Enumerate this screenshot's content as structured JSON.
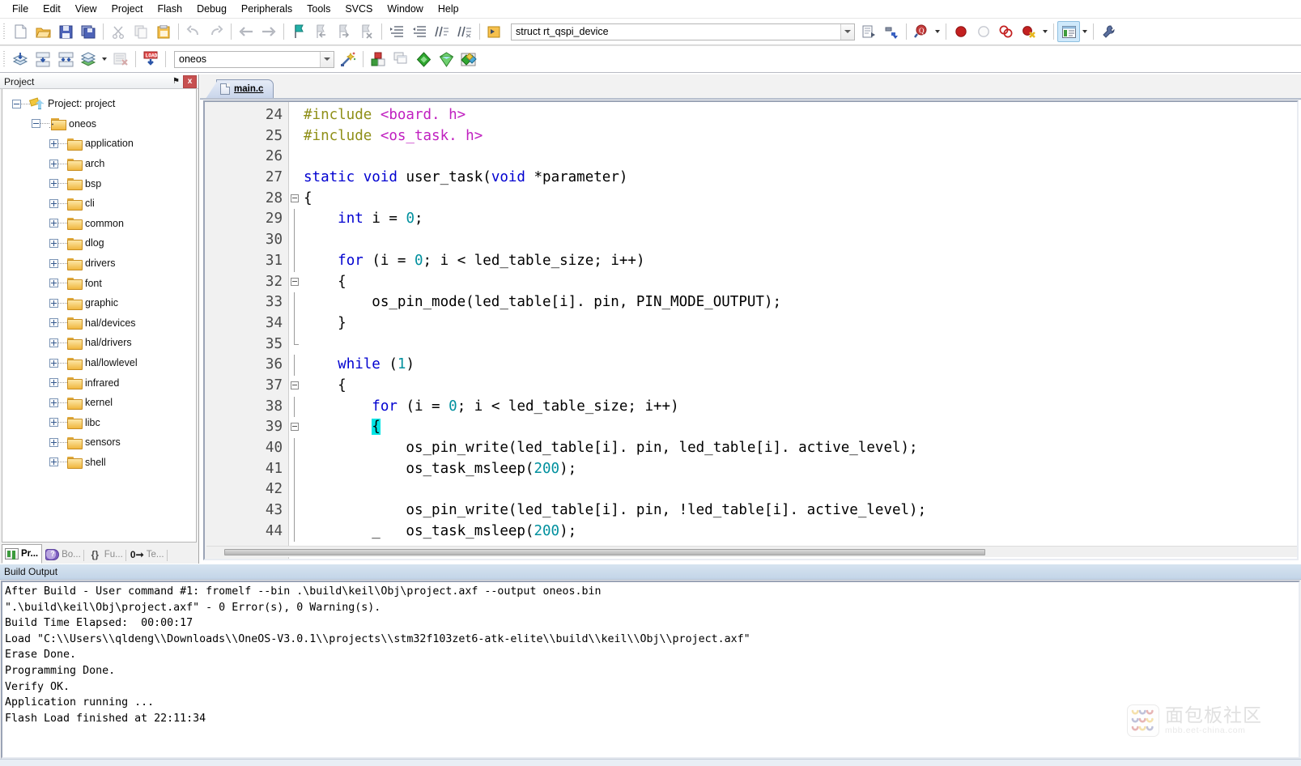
{
  "menubar": {
    "items": [
      "File",
      "Edit",
      "View",
      "Project",
      "Flash",
      "Debug",
      "Peripherals",
      "Tools",
      "SVCS",
      "Window",
      "Help"
    ]
  },
  "toolbar_main": {
    "buttons": [
      {
        "name": "new-file",
        "icon": "new-document-icon",
        "label": "New"
      },
      {
        "name": "open-file",
        "icon": "open-folder-icon",
        "label": "Open"
      },
      {
        "name": "save-file",
        "icon": "floppy-save-icon",
        "label": "Save"
      },
      {
        "name": "save-all",
        "icon": "save-all-icon",
        "label": "Save All"
      },
      {
        "name": "cut",
        "icon": "scissors-icon",
        "label": "Cut"
      },
      {
        "name": "copy",
        "icon": "copy-icon",
        "label": "Copy"
      },
      {
        "name": "paste",
        "icon": "clipboard-paste-icon",
        "label": "Paste"
      },
      {
        "name": "undo",
        "icon": "undo-arrow-icon",
        "label": "Undo"
      },
      {
        "name": "redo",
        "icon": "redo-arrow-icon",
        "label": "Redo"
      },
      {
        "name": "navigate-back",
        "icon": "arrow-left-icon",
        "label": "Back"
      },
      {
        "name": "navigate-forward",
        "icon": "arrow-right-icon",
        "label": "Forward"
      },
      {
        "name": "toggle-bookmark",
        "icon": "bookmark-flag-icon",
        "label": "Insert/Remove Bookmark"
      },
      {
        "name": "prev-bookmark",
        "icon": "bookmark-prev-icon",
        "label": "Previous Bookmark"
      },
      {
        "name": "next-bookmark",
        "icon": "bookmark-next-icon",
        "label": "Next Bookmark"
      },
      {
        "name": "clear-bookmarks",
        "icon": "bookmark-clear-icon",
        "label": "Clear All Bookmarks"
      },
      {
        "name": "indent-right",
        "icon": "indent-right-icon",
        "label": "Indent"
      },
      {
        "name": "indent-left",
        "icon": "indent-left-icon",
        "label": "Outdent"
      },
      {
        "name": "comment-block",
        "icon": "comment-lines-icon",
        "label": "Comment"
      },
      {
        "name": "uncomment-block",
        "icon": "uncomment-lines-icon",
        "label": "Uncomment"
      }
    ],
    "symbol_combo": {
      "value": "struct rt_qspi_device",
      "placeholder": "struct rt_qspi_device"
    },
    "buttons_right": [
      {
        "name": "browse-symbols",
        "icon": "document-browse-icon",
        "label": "Browse Symbols"
      },
      {
        "name": "build-target",
        "icon": "hammer-target-icon",
        "label": "Build Target"
      },
      {
        "name": "find-in-files",
        "icon": "find-magnifier-icon",
        "label": "Find in Files"
      },
      {
        "name": "insert-breakpoint",
        "icon": "red-circle-breakpoint-icon",
        "label": "Insert/Remove Breakpoint"
      },
      {
        "name": "disable-breakpoint",
        "icon": "hollow-circle-breakpoint-icon",
        "label": "Disable Breakpoint"
      },
      {
        "name": "disable-all-breakpoints",
        "icon": "two-rings-breakpoint-icon",
        "label": "Disable All Breakpoints"
      },
      {
        "name": "kill-all-breakpoints",
        "icon": "breakpoint-kill-icon",
        "label": "Kill All Breakpoints"
      },
      {
        "name": "manage-windows",
        "icon": "window-layout-icon",
        "label": "Manage Windows"
      },
      {
        "name": "configure-target",
        "icon": "wrench-icon",
        "label": "Configure Target Options"
      }
    ]
  },
  "toolbar_build": {
    "buttons": [
      {
        "name": "translate-file",
        "icon": "translate-layers-icon",
        "label": "Translate"
      },
      {
        "name": "build",
        "icon": "build-down-icon",
        "label": "Build"
      },
      {
        "name": "rebuild",
        "icon": "rebuild-all-icon",
        "label": "Rebuild"
      },
      {
        "name": "batch-build",
        "icon": "batch-build-icon",
        "label": "Batch Build"
      },
      {
        "name": "stop-build",
        "icon": "stop-build-icon",
        "label": "Stop Build"
      },
      {
        "name": "download-to-flash",
        "icon": "load-flash-icon",
        "label": "Download"
      }
    ],
    "target_combo": {
      "value": "oneos",
      "placeholder": "oneos"
    },
    "buttons_right": [
      {
        "name": "manage-project-items",
        "icon": "magic-wand-icon",
        "label": "Manage Project Items"
      },
      {
        "name": "select-components",
        "icon": "components-blocks-icon",
        "label": "Select Software Packs"
      },
      {
        "name": "multi-project-window",
        "icon": "multi-window-icon",
        "label": "Multi-Project Window"
      },
      {
        "name": "pack-installer",
        "icon": "green-diamond-icon",
        "label": "Pack Installer"
      },
      {
        "name": "pack-filter",
        "icon": "funnel-icon",
        "label": "Filter Packs"
      },
      {
        "name": "pack-manage",
        "icon": "pack-manage-icon",
        "label": "Manage Packs"
      }
    ]
  },
  "project_panel": {
    "title": "Project",
    "pin_label": "⚑",
    "close_label": "x",
    "tree": [
      {
        "label": "Project: project",
        "icon": "project-icon",
        "expander": "minus",
        "depth": 0
      },
      {
        "label": "oneos",
        "icon": "target-group-icon",
        "expander": "minus",
        "depth": 1
      },
      {
        "label": "application",
        "icon": "folder-icon",
        "expander": "plus",
        "depth": 2
      },
      {
        "label": "arch",
        "icon": "folder-icon",
        "expander": "plus",
        "depth": 2
      },
      {
        "label": "bsp",
        "icon": "folder-icon",
        "expander": "plus",
        "depth": 2
      },
      {
        "label": "cli",
        "icon": "folder-icon",
        "expander": "plus",
        "depth": 2
      },
      {
        "label": "common",
        "icon": "folder-icon",
        "expander": "plus",
        "depth": 2
      },
      {
        "label": "dlog",
        "icon": "folder-icon",
        "expander": "plus",
        "depth": 2
      },
      {
        "label": "drivers",
        "icon": "folder-icon",
        "expander": "plus",
        "depth": 2
      },
      {
        "label": "font",
        "icon": "folder-icon",
        "expander": "plus",
        "depth": 2
      },
      {
        "label": "graphic",
        "icon": "folder-icon",
        "expander": "plus",
        "depth": 2
      },
      {
        "label": "hal/devices",
        "icon": "folder-icon",
        "expander": "plus",
        "depth": 2
      },
      {
        "label": "hal/drivers",
        "icon": "folder-icon",
        "expander": "plus",
        "depth": 2
      },
      {
        "label": "hal/lowlevel",
        "icon": "folder-icon",
        "expander": "plus",
        "depth": 2
      },
      {
        "label": "infrared",
        "icon": "folder-icon",
        "expander": "plus",
        "depth": 2
      },
      {
        "label": "kernel",
        "icon": "folder-icon",
        "expander": "plus",
        "depth": 2
      },
      {
        "label": "libc",
        "icon": "folder-icon",
        "expander": "plus",
        "depth": 2
      },
      {
        "label": "sensors",
        "icon": "folder-icon",
        "expander": "plus",
        "depth": 2
      },
      {
        "label": "shell",
        "icon": "folder-icon",
        "expander": "plus",
        "depth": 2
      }
    ],
    "tabs": [
      {
        "label": "Pr...",
        "icon": "project-view-icon",
        "selected": true
      },
      {
        "label": "Bo...",
        "icon": "books-view-icon",
        "selected": false
      },
      {
        "label": "Fu...",
        "icon": "functions-view-icon",
        "selected": false
      },
      {
        "label": "Te...",
        "icon": "templates-view-icon",
        "selected": false
      }
    ]
  },
  "editor": {
    "tabs": [
      {
        "label": "main.c",
        "icon": "c-document-icon",
        "selected": true
      }
    ],
    "first_line": 24,
    "lines": [
      {
        "n": 24,
        "fold": "",
        "tokens": [
          {
            "t": "#include ",
            "c": "pp"
          },
          {
            "t": "<board. h>",
            "c": "inc"
          }
        ]
      },
      {
        "n": 25,
        "fold": "",
        "tokens": [
          {
            "t": "#include ",
            "c": "pp"
          },
          {
            "t": "<os_task. h>",
            "c": "inc"
          }
        ]
      },
      {
        "n": 26,
        "fold": "",
        "tokens": []
      },
      {
        "n": 27,
        "fold": "",
        "tokens": [
          {
            "t": "static ",
            "c": "kw"
          },
          {
            "t": "void ",
            "c": "kw"
          },
          {
            "t": "user_task(",
            "c": ""
          },
          {
            "t": "void ",
            "c": "kw"
          },
          {
            "t": "*parameter)",
            "c": ""
          }
        ]
      },
      {
        "n": 28,
        "fold": "box",
        "tokens": [
          {
            "t": "{",
            "c": ""
          }
        ]
      },
      {
        "n": 29,
        "fold": "bar",
        "tokens": [
          {
            "t": "    ",
            "c": ""
          },
          {
            "t": "int ",
            "c": "kw"
          },
          {
            "t": "i = ",
            "c": ""
          },
          {
            "t": "0",
            "c": "num-lit"
          },
          {
            "t": ";",
            "c": ""
          }
        ]
      },
      {
        "n": 30,
        "fold": "bar",
        "tokens": []
      },
      {
        "n": 31,
        "fold": "bar",
        "tokens": [
          {
            "t": "    ",
            "c": ""
          },
          {
            "t": "for ",
            "c": "kw"
          },
          {
            "t": "(i = ",
            "c": ""
          },
          {
            "t": "0",
            "c": "num-lit"
          },
          {
            "t": "; i < led_table_size; i++)",
            "c": ""
          }
        ]
      },
      {
        "n": 32,
        "fold": "box",
        "tokens": [
          {
            "t": "    {",
            "c": ""
          }
        ]
      },
      {
        "n": 33,
        "fold": "bar",
        "tokens": [
          {
            "t": "        os_pin_mode(led_table[i]. pin, PIN_MODE_OUTPUT);",
            "c": ""
          }
        ]
      },
      {
        "n": 34,
        "fold": "bar",
        "tokens": [
          {
            "t": "    }",
            "c": ""
          }
        ]
      },
      {
        "n": 35,
        "fold": "end",
        "tokens": []
      },
      {
        "n": 36,
        "fold": "bar",
        "tokens": [
          {
            "t": "    ",
            "c": ""
          },
          {
            "t": "while ",
            "c": "kw"
          },
          {
            "t": "(",
            "c": ""
          },
          {
            "t": "1",
            "c": "num-lit"
          },
          {
            "t": ")",
            "c": ""
          }
        ]
      },
      {
        "n": 37,
        "fold": "box",
        "tokens": [
          {
            "t": "    {",
            "c": ""
          }
        ]
      },
      {
        "n": 38,
        "fold": "bar",
        "tokens": [
          {
            "t": "        ",
            "c": ""
          },
          {
            "t": "for ",
            "c": "kw"
          },
          {
            "t": "(i = ",
            "c": ""
          },
          {
            "t": "0",
            "c": "num-lit"
          },
          {
            "t": "; i < led_table_size; i++)",
            "c": ""
          }
        ]
      },
      {
        "n": 39,
        "fold": "box",
        "tokens": [
          {
            "t": "        ",
            "c": ""
          },
          {
            "t": "{",
            "c": "sel-char"
          }
        ]
      },
      {
        "n": 40,
        "fold": "bar",
        "tokens": [
          {
            "t": "            os_pin_write(led_table[i]. pin, led_table[i]. active_level);",
            "c": ""
          }
        ]
      },
      {
        "n": 41,
        "fold": "bar",
        "tokens": [
          {
            "t": "            os_task_msleep(",
            "c": ""
          },
          {
            "t": "200",
            "c": "num-lit"
          },
          {
            "t": ");",
            "c": ""
          }
        ]
      },
      {
        "n": 42,
        "fold": "bar",
        "tokens": []
      },
      {
        "n": 43,
        "fold": "bar",
        "tokens": [
          {
            "t": "            os_pin_write(led_table[i]. pin, !led_table[i]. active_level);",
            "c": ""
          }
        ]
      },
      {
        "n": 44,
        "fold": "bar",
        "tokens": [
          {
            "t": "        _   os_task_msleep(",
            "c": ""
          },
          {
            "t": "200",
            "c": "num-lit"
          },
          {
            "t": ");",
            "c": ""
          }
        ]
      }
    ]
  },
  "build_output": {
    "title": "Build Output",
    "lines": [
      "After Build - User command #1: fromelf --bin .\\build\\keil\\Obj\\project.axf --output oneos.bin",
      "\".\\build\\keil\\Obj\\project.axf\" - 0 Error(s), 0 Warning(s).",
      "Build Time Elapsed:  00:00:17",
      "Load \"C:\\\\Users\\\\qldeng\\\\Downloads\\\\OneOS-V3.0.1\\\\projects\\\\stm32f103zet6-atk-elite\\\\build\\\\keil\\\\Obj\\\\project.axf\"",
      "Erase Done.",
      "Programming Done.",
      "Verify OK.",
      "Application running ...",
      "Flash Load finished at 22:11:34"
    ]
  },
  "watermark": {
    "cn": "面包板社区",
    "en": "mbb.eet-china.com"
  },
  "colors": {
    "keyword": "#0000d0",
    "preprocessor": "#8f8f18",
    "include_path": "#c020c0",
    "number": "#00909e",
    "selection": "#00e5e5",
    "build_title_bg": "#c3d5e8",
    "tab_active_bg": "#c8d4ea"
  }
}
